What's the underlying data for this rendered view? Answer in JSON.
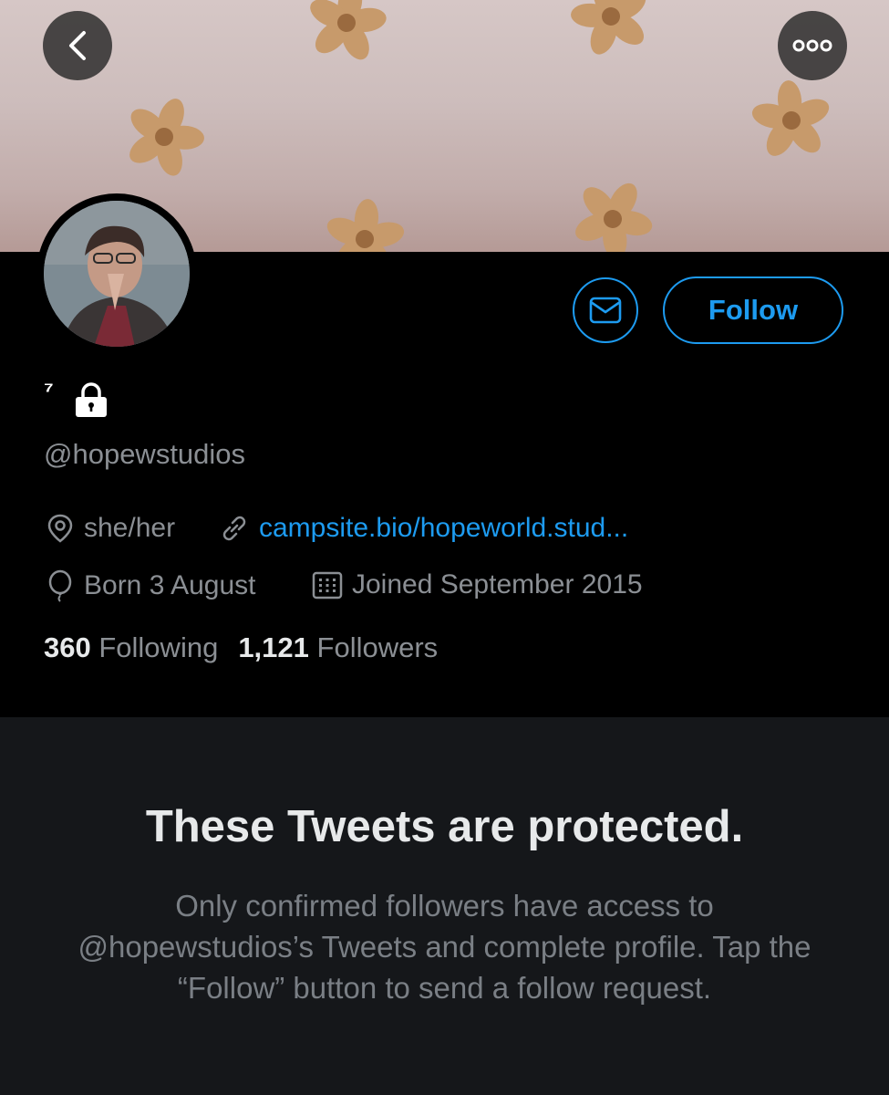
{
  "header": {
    "back_icon": "chevron-left-icon",
    "more_icon": "ellipsis-icon"
  },
  "profile": {
    "display_name": "⁷",
    "protected_icon": "lock-icon",
    "handle": "@hopewstudios",
    "message_icon": "envelope-icon",
    "follow_label": "Follow",
    "location": "she/her",
    "website": "campsite.bio/hopeworld.stud...",
    "birthday": "Born 3 August",
    "joined": "Joined September 2015",
    "following_count": "360",
    "following_label": "Following",
    "followers_count": "1,121",
    "followers_label": "Followers"
  },
  "protected_notice": {
    "title": "These Tweets are protected.",
    "body": "Only confirmed followers have access to @hopewstudios’s Tweets and complete profile. Tap the “Follow” button to send a follow request."
  },
  "colors": {
    "accent": "#1d9bf0",
    "background": "#000000",
    "panel": "#15171a",
    "muted_text": "#8b8f94"
  }
}
